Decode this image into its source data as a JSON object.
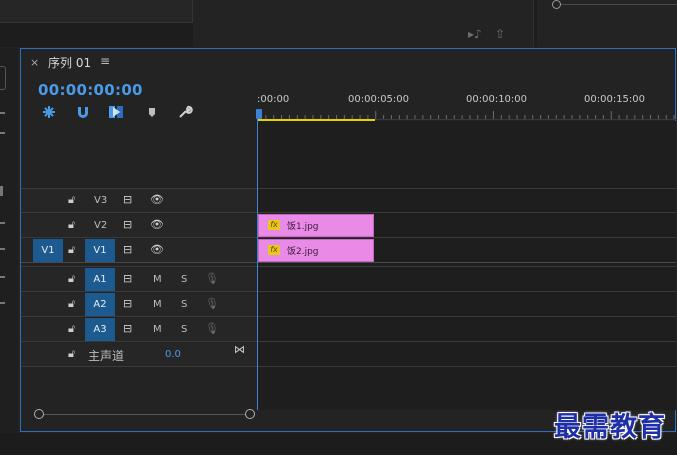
{
  "sequence": {
    "close_label": "×",
    "title": "序列 01",
    "menu_label": "≡",
    "timecode": "00:00:00:00"
  },
  "toolbar": {
    "icons": [
      "snap-icon",
      "magnet-icon",
      "linked-selection-icon",
      "marker-icon",
      "wrench-icon"
    ]
  },
  "ruler": {
    "labels": [
      ":00:00",
      "00:00:05:00",
      "00:00:10:00",
      "00:00:15:00"
    ]
  },
  "video_tracks": [
    {
      "name": "V3",
      "source": ""
    },
    {
      "name": "V2",
      "source": ""
    },
    {
      "name": "V1",
      "source": "V1"
    }
  ],
  "audio_tracks": [
    {
      "name": "A1",
      "mute": "M",
      "solo": "S"
    },
    {
      "name": "A2",
      "mute": "M",
      "solo": "S"
    },
    {
      "name": "A3",
      "mute": "M",
      "solo": "S"
    }
  ],
  "master": {
    "label": "主声道",
    "value": "0.0"
  },
  "clips": [
    {
      "fx": "fx",
      "name": "饭1.jpg",
      "track": "V2"
    },
    {
      "fx": "fx",
      "name": "饭2.jpg",
      "track": "V1"
    }
  ],
  "watermark": "最需教育",
  "colors": {
    "accent": "#4a9ae8",
    "track_button": "#1c5a8f",
    "clip": "#e98be6",
    "work_area": "#e6d200"
  }
}
